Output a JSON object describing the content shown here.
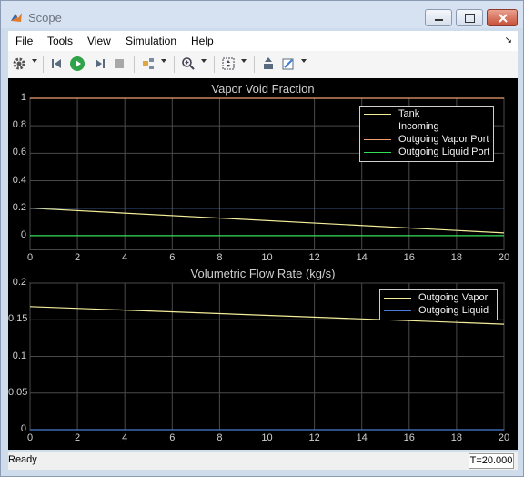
{
  "window": {
    "title": "Scope"
  },
  "menu": [
    "File",
    "Tools",
    "View",
    "Simulation",
    "Help"
  ],
  "toolbar": {
    "icons": [
      "gear-icon",
      "step-back-icon",
      "run-icon",
      "step-forward-icon",
      "stop-icon",
      "signal-selector-icon",
      "zoom-icon",
      "autoscale-icon",
      "highlight-block-icon",
      "style-icon"
    ]
  },
  "colors": {
    "tank": "#f4ee9a",
    "incoming": "#4a7ed6",
    "outgoing_vapor_port": "#f0a070",
    "outgoing_liquid_port": "#33dd55",
    "outgoing_vapor": "#f4ee9a",
    "outgoing_liquid": "#4a7ed6",
    "run": "#2ea34a"
  },
  "chart_data": [
    {
      "type": "line",
      "title": "Vapor Void Fraction",
      "xlim": [
        0,
        20
      ],
      "ylim": [
        -0.1,
        1.0
      ],
      "xticks": [
        "0",
        "2",
        "4",
        "6",
        "8",
        "10",
        "12",
        "14",
        "16",
        "18",
        "20"
      ],
      "yticks": [
        "0",
        "0.2",
        "0.4",
        "0.6",
        "0.8",
        "1"
      ],
      "grid": true,
      "legend_position": "top-right",
      "series": [
        {
          "name": "Tank",
          "x": [
            0,
            20
          ],
          "y": [
            0.2,
            0.02
          ]
        },
        {
          "name": "Incoming",
          "x": [
            0,
            20
          ],
          "y": [
            0.2,
            0.2
          ]
        },
        {
          "name": "Outgoing Vapor Port",
          "x": [
            0,
            20
          ],
          "y": [
            1.0,
            1.0
          ]
        },
        {
          "name": "Outgoing Liquid Port",
          "x": [
            0,
            20
          ],
          "y": [
            0.0,
            0.0
          ]
        }
      ]
    },
    {
      "type": "line",
      "title": "Volumetric Flow Rate (kg/s)",
      "xlim": [
        0,
        20
      ],
      "ylim": [
        0,
        0.2
      ],
      "xticks": [
        "0",
        "2",
        "4",
        "6",
        "8",
        "10",
        "12",
        "14",
        "16",
        "18",
        "20"
      ],
      "yticks": [
        "0",
        "0.05",
        "0.1",
        "0.15",
        "0.2"
      ],
      "grid": true,
      "legend_position": "top-right",
      "series": [
        {
          "name": "Outgoing Vapor",
          "x": [
            0,
            20
          ],
          "y": [
            0.168,
            0.144
          ]
        },
        {
          "name": "Outgoing Liquid",
          "x": [
            0,
            20
          ],
          "y": [
            0.0,
            0.0
          ]
        }
      ]
    }
  ],
  "status": {
    "text": "Ready",
    "time": "T=20.000"
  }
}
